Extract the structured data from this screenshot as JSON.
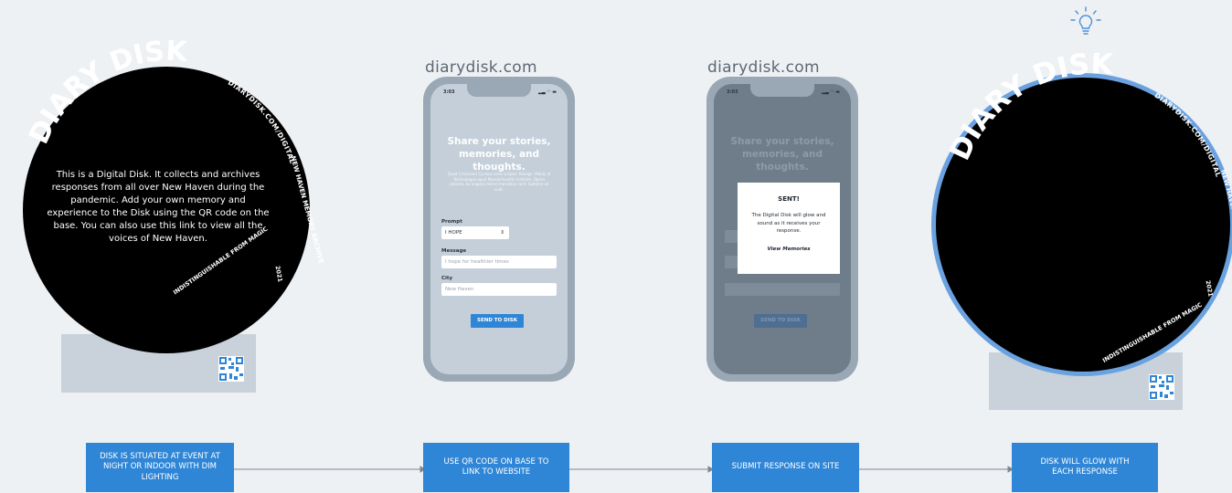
{
  "disk1": {
    "brand": "DIARY DISK",
    "ring_text_right": "DIARYDISK.COM/DIGITAL",
    "ring_text_side": "NEW HAVEN MEMORY ARCHIVE",
    "ring_year": "2021",
    "ring_text_bottom": "INDISTINGUISHABLE FROM MAGIC",
    "body": "This is a Digital Disk. It collects and archives responses from all over New Haven during the pandemic.  Add your own memory and experience to the Disk using the QR code on the base. You can also use this link to view all the voices of New Haven."
  },
  "phone1": {
    "url": "diarydisk.com",
    "time": "3:03",
    "title": "Share your stories, memories, and thoughts.",
    "subtitle": "Quod Cristinium Cycleas esse scriptor. Realign. Maldy of Technologue apud Massachusetts Institute. Opera collecta. Ex angelus latine translatus sunt. Sublime ad sunt.",
    "prompt_label": "Prompt",
    "prompt_value": "I HOPE",
    "message_label": "Message",
    "message_placeholder": "I hope for healthier times",
    "city_label": "City",
    "city_placeholder": "New Haven",
    "send_label": "SEND TO DISK"
  },
  "phone2": {
    "url": "diarydisk.com",
    "time": "3:03",
    "title": "Share your stories, memories, and thoughts.",
    "modal_title": "SENT!",
    "modal_body": "The Digital Disk will glow and sound as it receives your response.",
    "modal_link": "View Memories",
    "send_label": "SEND TO DISK"
  },
  "disk2": {
    "brand": "DIARY DISK",
    "ring_text_right": "DIARYDISK.COM/DIGITAL",
    "ring_text_side": "NEW HAVEN MEMORY ARCHIVE",
    "ring_year": "2021",
    "ring_text_bottom": "INDISTINGUISHABLE FROM MAGIC",
    "bulb_icon": "lightbulb-icon",
    "glow_color": "#6aa2e0"
  },
  "steps": [
    "DISK IS SITUATED AT EVENT AT NIGHT OR INDOOR WITH DIM LIGHTING",
    "USE QR CODE ON BASE TO LINK TO WEBSITE",
    "SUBMIT RESPONSE ON SITE",
    "DISK WILL GLOW WITH EACH RESPONSE"
  ],
  "colors": {
    "background": "#eef1f4",
    "step_blue": "#2f86d6",
    "disk_black": "#000000",
    "base_gray": "#c9d1da"
  }
}
